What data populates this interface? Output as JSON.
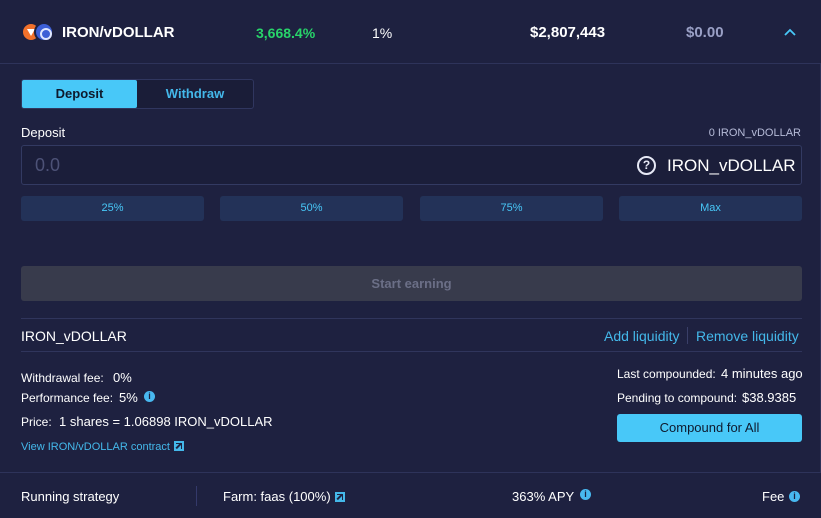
{
  "header": {
    "pair_name": "IRON/vDOLLAR",
    "apy": "3,668.4%",
    "daily": "1%",
    "tvl": "$2,807,443",
    "balance": "$0.00"
  },
  "tabs": {
    "deposit": "Deposit",
    "withdraw": "Withdraw"
  },
  "deposit": {
    "label": "Deposit",
    "balance": "0 IRON_vDOLLAR",
    "placeholder": "0.0",
    "token": "IRON_vDOLLAR",
    "help_icon": "question-circle-icon"
  },
  "percent_buttons": [
    "25%",
    "50%",
    "75%",
    "Max"
  ],
  "start_button": "Start earning",
  "lp": {
    "name": "IRON_vDOLLAR",
    "add_liquidity": "Add liquidity",
    "remove_liquidity": "Remove liquidity"
  },
  "fees": {
    "withdrawal_label": "Withdrawal fee:",
    "withdrawal_value": "0%",
    "performance_label": "Performance fee:",
    "performance_value": "5%",
    "price_label": "Price:",
    "price_value": "1 shares = 1.06898 IRON_vDOLLAR",
    "contract_link": "View IRON/vDOLLAR contract"
  },
  "compound": {
    "last_label": "Last compounded:",
    "last_value": "4 minutes ago",
    "pending_label": "Pending to compound:",
    "pending_value": "$38.9385",
    "button": "Compound for All"
  },
  "footer": {
    "strategy": "Running strategy",
    "farm": "Farm: faas (100%)",
    "apy": "363% APY",
    "fee": "Fee"
  },
  "colors": {
    "background": "#1e2140",
    "accent": "#48c8f8",
    "apy_green": "#28d46a",
    "disabled": "#383b4c"
  }
}
